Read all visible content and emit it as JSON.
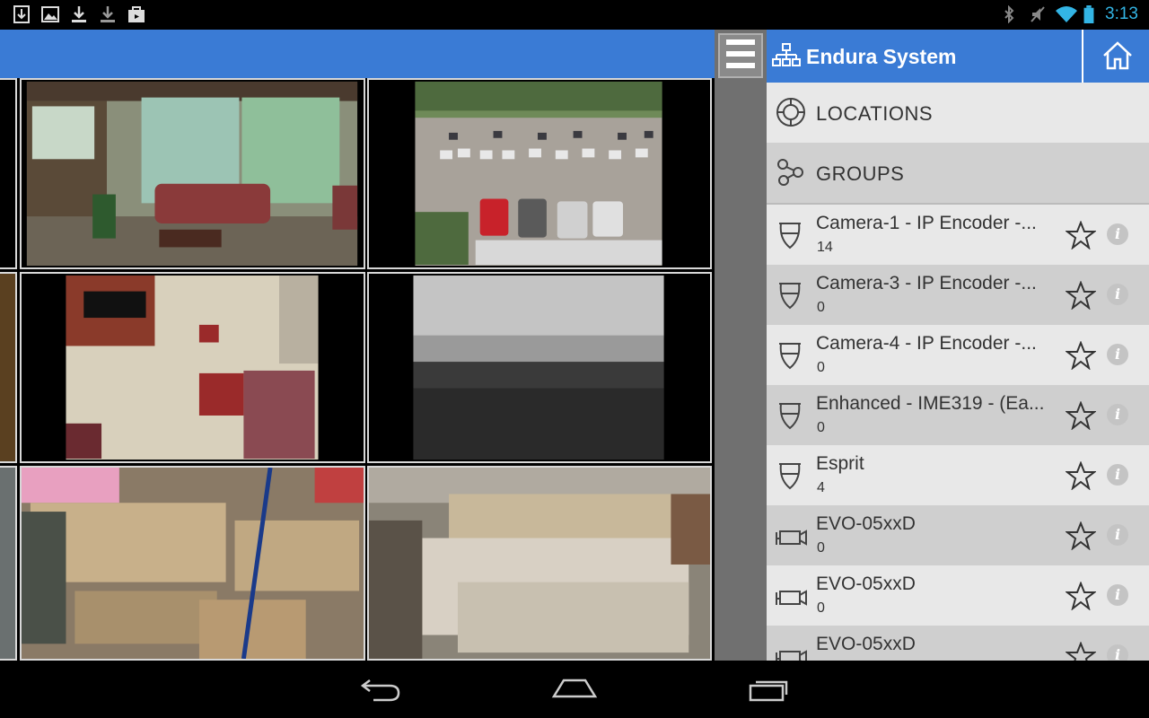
{
  "status_bar": {
    "time": "3:13",
    "notification_icons": [
      "download-icon",
      "image-icon",
      "download-icon",
      "download-icon",
      "shopping-bag-icon"
    ],
    "system_icons": [
      "bluetooth-icon",
      "mute-icon",
      "wifi-icon",
      "battery-icon"
    ]
  },
  "panel": {
    "title": "Endura System",
    "nav": [
      {
        "label": "LOCATIONS",
        "icon": "locations-icon"
      },
      {
        "label": "GROUPS",
        "icon": "groups-icon"
      }
    ],
    "cameras": [
      {
        "name": "Camera-1 - IP Encoder -...",
        "count": "14",
        "icon": "dome-camera-icon"
      },
      {
        "name": "Camera-3 - IP Encoder -...",
        "count": "0",
        "icon": "dome-camera-icon"
      },
      {
        "name": "Camera-4 - IP Encoder -...",
        "count": "0",
        "icon": "dome-camera-icon"
      },
      {
        "name": "Enhanced - IME319 - (Ea...",
        "count": "0",
        "icon": "dome-camera-icon"
      },
      {
        "name": "Esprit",
        "count": "4",
        "icon": "dome-camera-icon"
      },
      {
        "name": "EVO-05xxD",
        "count": "0",
        "icon": "box-camera-icon"
      },
      {
        "name": "EVO-05xxD",
        "count": "0",
        "icon": "box-camera-icon"
      },
      {
        "name": "EVO-05xxD",
        "count": "",
        "icon": "box-camera-icon"
      }
    ],
    "info_glyph": "i"
  },
  "video_tiles": [
    {
      "scene": "lobby"
    },
    {
      "scene": "parking-lot"
    },
    {
      "scene": "reception-hall"
    },
    {
      "scene": "field-infrared"
    },
    {
      "scene": "warehouse-left"
    },
    {
      "scene": "warehouse-right"
    }
  ],
  "colors": {
    "accent": "#3a7bd5",
    "clock": "#33b5e5",
    "row_light": "#e8e8e8",
    "row_dark": "#cfcfcf"
  }
}
